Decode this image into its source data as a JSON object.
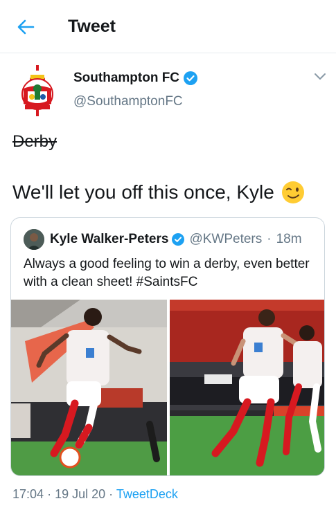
{
  "header": {
    "title": "Tweet",
    "back_icon": "back-arrow-icon"
  },
  "tweet": {
    "author_name": "Southampton FC",
    "author_handle": "@SouthamptonFC",
    "struck_text": "Derby",
    "text": "We'll let you off this once, Kyle",
    "emoji": "winking-face",
    "quoted": {
      "name": "Kyle Walker-Peters",
      "handle": "@KWPeters",
      "separator": "·",
      "age": "18m",
      "text": "Always a good feeling to win a derby, even better with a clean sheet! #SaintsFC"
    },
    "meta": {
      "time": "17:04",
      "sep1": "·",
      "date": "19 Jul 20",
      "sep2": "·",
      "source": "TweetDeck"
    }
  },
  "colors": {
    "accent": "#1da1f2",
    "secondary_text": "#657786",
    "kit_red": "#d71920",
    "pitch": "#3f8f3a"
  }
}
